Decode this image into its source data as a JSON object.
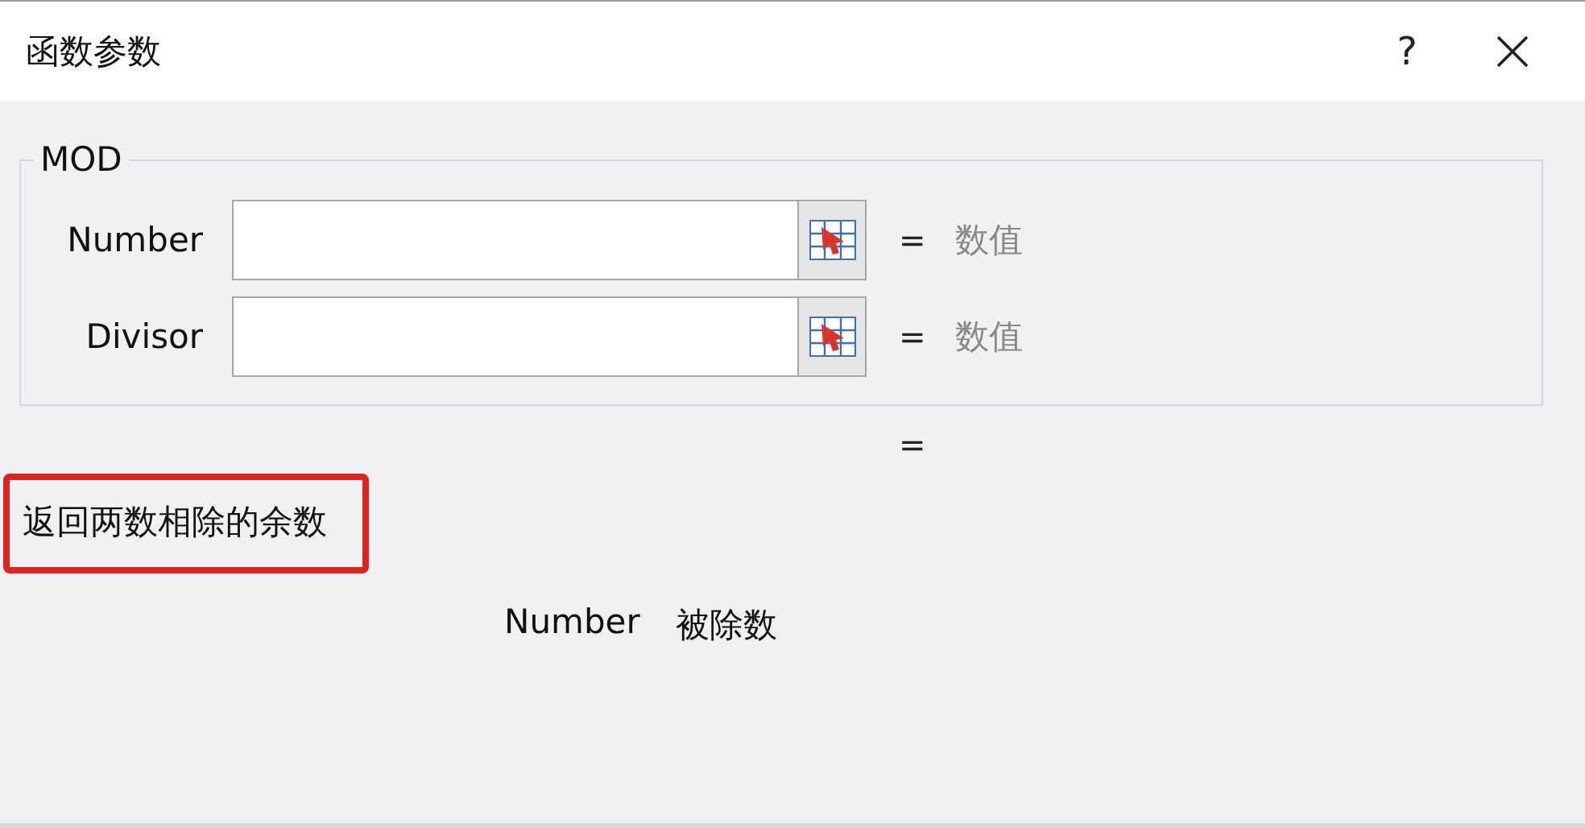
{
  "window": {
    "title": "函数参数",
    "help": "?"
  },
  "function_group": {
    "name": "MOD",
    "arguments": [
      {
        "label": "Number",
        "equals": "=",
        "result": "数值"
      },
      {
        "label": "Divisor",
        "equals": "=",
        "result": "数值"
      }
    ]
  },
  "formula_result": {
    "equals": "="
  },
  "description": {
    "text": "返回两数相除的余数",
    "highlighted": true
  },
  "argument_help": {
    "name": "Number",
    "text": "被除数"
  }
}
